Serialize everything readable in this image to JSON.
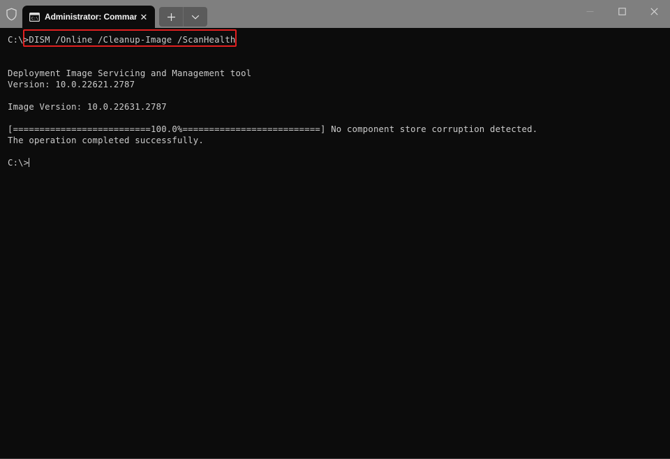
{
  "window": {
    "titlebar": {
      "shield_icon": "shield-icon",
      "tab": {
        "icon": "command-prompt-icon",
        "title": "Administrator: Command Pro",
        "close_label": "✕"
      },
      "new_tab_label": "+",
      "dropdown_label": "⌄",
      "controls": {
        "minimize": "minimize-icon",
        "maximize": "maximize-icon",
        "close": "close-icon"
      }
    },
    "terminal": {
      "lines": [
        {
          "id": "prompt_command",
          "text": "C:\\>DISM /Online /Cleanup-Image /ScanHealth"
        },
        {
          "id": "blank_1",
          "text": " "
        },
        {
          "id": "tool_name",
          "text": "Deployment Image Servicing and Management tool"
        },
        {
          "id": "tool_version",
          "text": "Version: 10.0.22621.2787"
        },
        {
          "id": "blank_2",
          "text": " "
        },
        {
          "id": "image_version",
          "text": "Image Version: 10.0.22631.2787"
        },
        {
          "id": "blank_3",
          "text": " "
        },
        {
          "id": "progress",
          "text": "[==========================100.0%==========================] No component store corruption detected."
        },
        {
          "id": "result",
          "text": "The operation completed successfully."
        },
        {
          "id": "blank_4",
          "text": " "
        }
      ],
      "final_prompt": "C:\\>",
      "progress_percent": "100.0%",
      "result_message": "The operation completed successfully.",
      "scan_message": "No component store corruption detected."
    },
    "annotation": {
      "highlight_color": "#e02020",
      "highlighted_text": "DISM /Online /Cleanup-Image /ScanHealth"
    }
  }
}
